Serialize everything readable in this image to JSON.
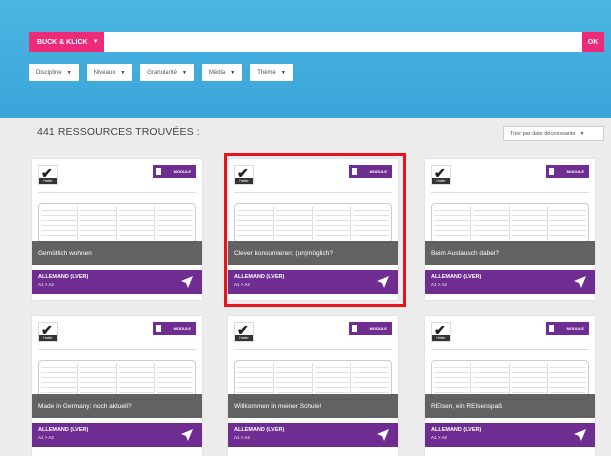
{
  "search": {
    "brand_label": "BUCK & KLICK",
    "ok_label": "OK"
  },
  "filters": [
    {
      "label": "Discipline"
    },
    {
      "label": "Niveaux"
    },
    {
      "label": "Granularité"
    },
    {
      "label": "Média"
    },
    {
      "label": "Thème"
    }
  ],
  "results": {
    "count_label": "441 RESSOURCES TROUVÉES :",
    "sort_label": "Trier par date décroissante"
  },
  "card_common": {
    "badge_label": "MODULE",
    "logo_text": "Hatier"
  },
  "cards": [
    {
      "title": "Gemütlich wohnen",
      "subject": "ALLEMAND (LVER)",
      "level": "A1 > A2",
      "highlighted": false
    },
    {
      "title": "Clever konsumieren: (un)möglich?",
      "subject": "ALLEMAND (LVER)",
      "level": "A1 > A2",
      "highlighted": true
    },
    {
      "title": "Beim Austausch dabei?",
      "subject": "ALLEMAND (LVER)",
      "level": "A1 > A2",
      "highlighted": false
    },
    {
      "title": "Made in Germany: noch aktuell?",
      "subject": "ALLEMAND (LVER)",
      "level": "A1 > A2",
      "highlighted": false
    },
    {
      "title": "Willkommen in meiner Schule!",
      "subject": "ALLEMAND (LVER)",
      "level": "A1 > A2",
      "highlighted": false
    },
    {
      "title": "REIsen, ein REIsenspaß",
      "subject": "ALLEMAND (LVER)",
      "level": "A1 > A2",
      "highlighted": false
    }
  ],
  "colors": {
    "brand": "#ee2a7b",
    "hero": "#3aa5d8",
    "card_footer": "#6f2d91",
    "highlight": "#e8131b"
  }
}
